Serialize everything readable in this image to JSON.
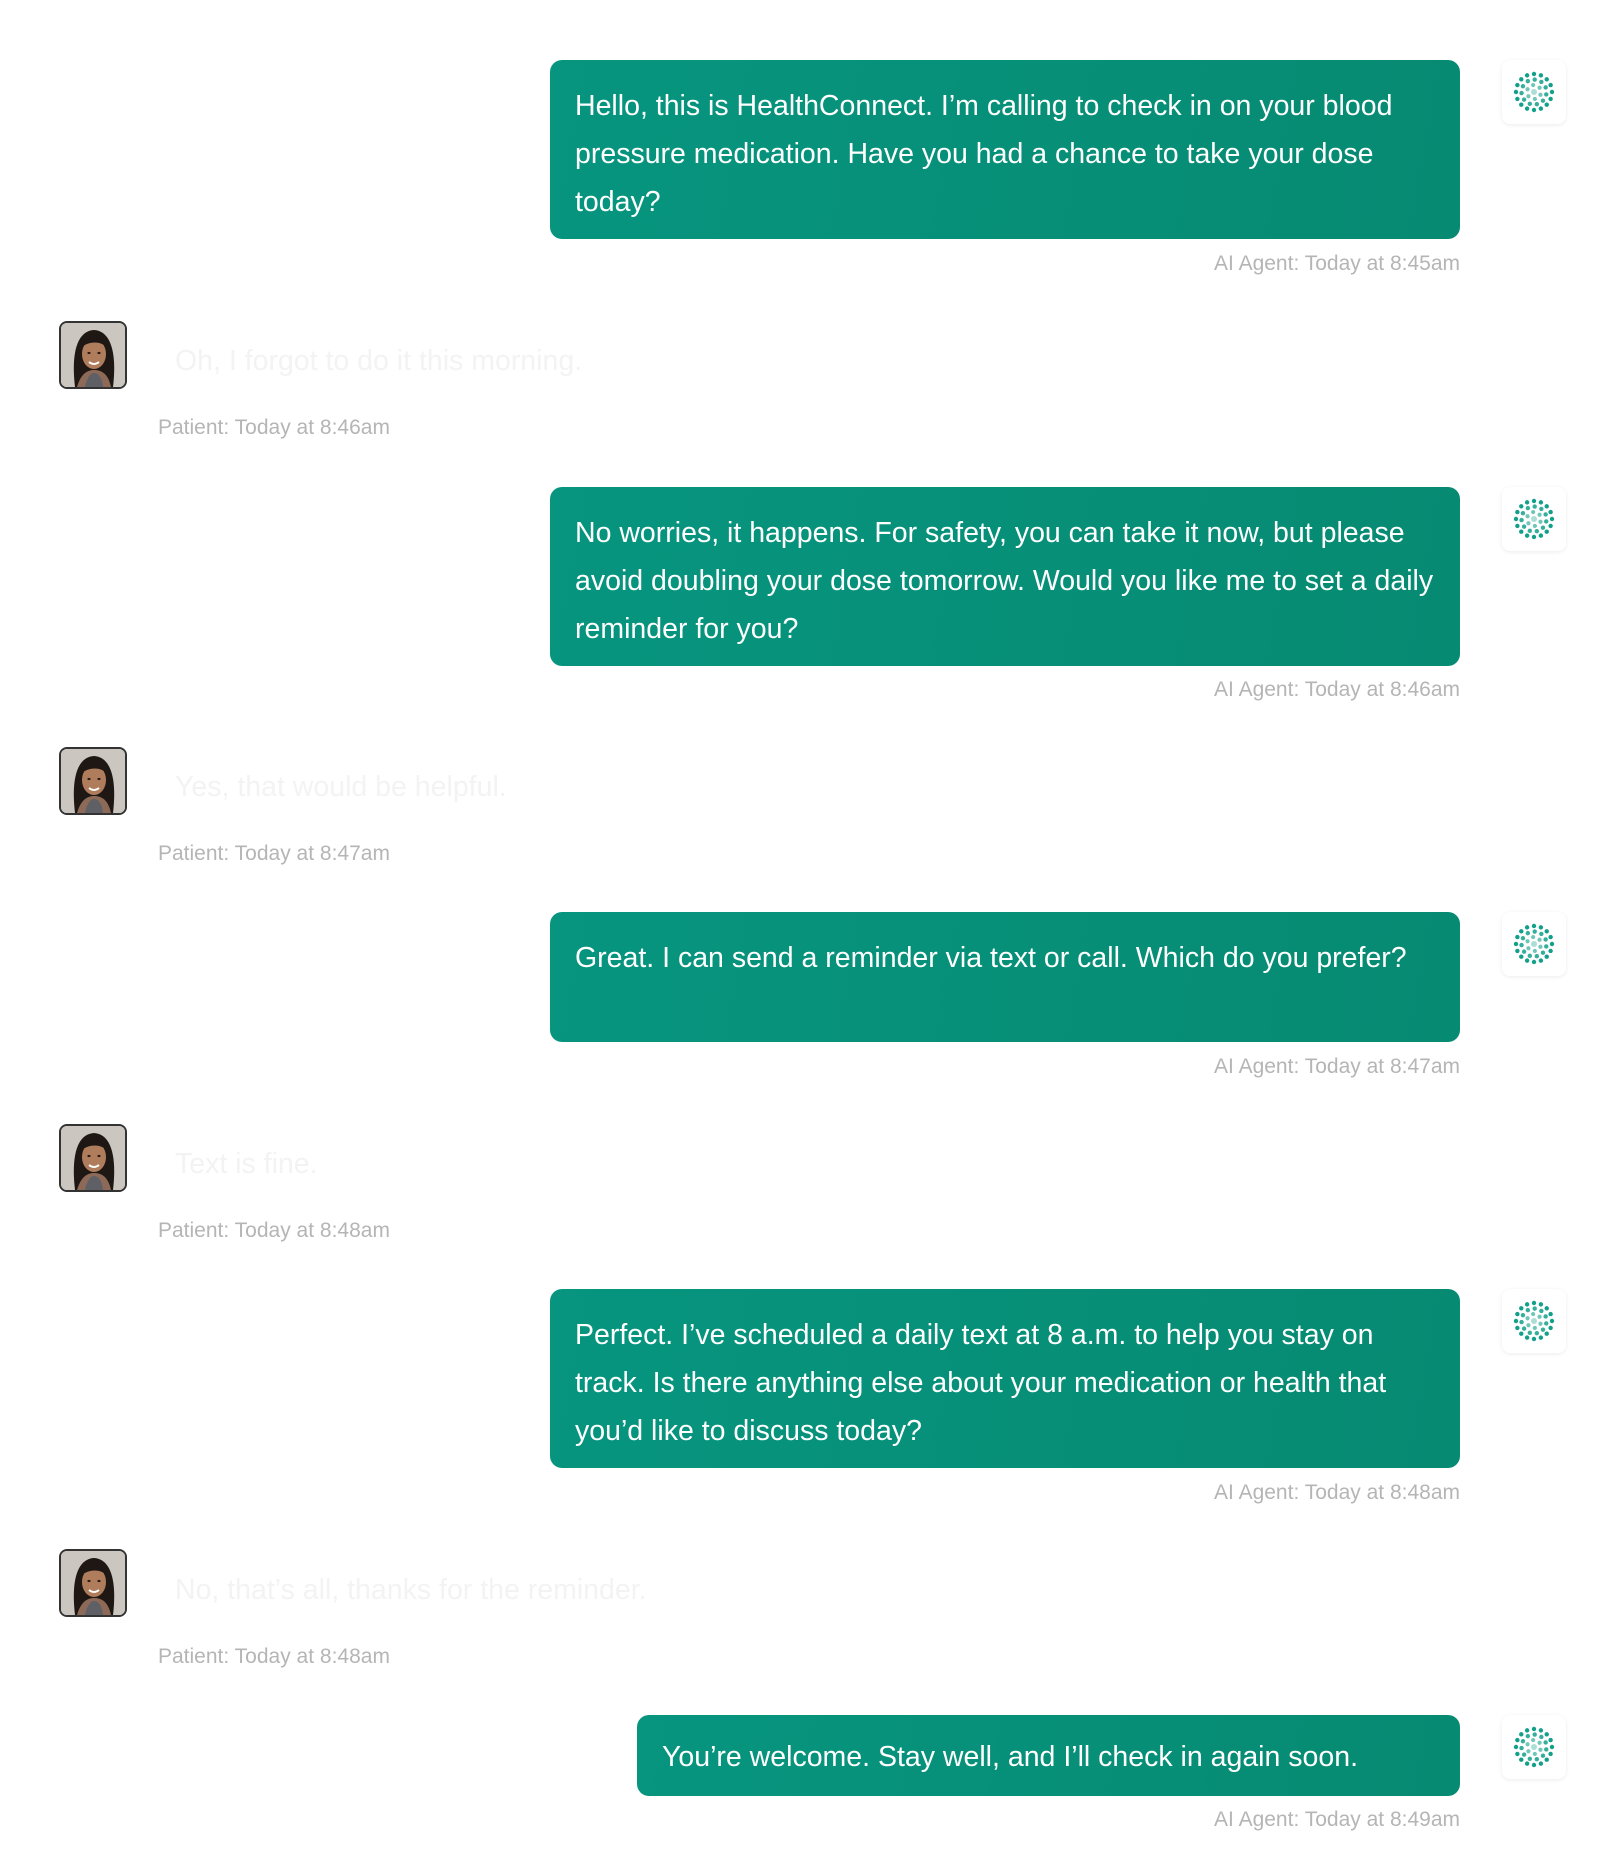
{
  "conversation": {
    "messages": [
      {
        "sender": "agent",
        "text": "Hello, this is HealthConnect. I’m calling to check in on your blood pressure medication. Have you had a chance to take your dose today?",
        "meta": "AI Agent: Today at 8:45am"
      },
      {
        "sender": "patient",
        "text": "Oh, I forgot to do it this morning.",
        "meta": "Patient: Today at 8:46am"
      },
      {
        "sender": "agent",
        "text": "No worries, it happens. For safety, you can take it now, but please avoid doubling your dose tomorrow. Would you like me to set a daily reminder for you?",
        "meta": "AI Agent: Today at 8:46am"
      },
      {
        "sender": "patient",
        "text": "Yes, that would be helpful.",
        "meta": "Patient: Today at 8:47am"
      },
      {
        "sender": "agent",
        "text": "Great. I can send a reminder via text or call. Which do you prefer?",
        "meta": "AI Agent: Today at 8:47am"
      },
      {
        "sender": "patient",
        "text": "Text is fine.",
        "meta": "Patient: Today at 8:48am"
      },
      {
        "sender": "agent",
        "text": "Perfect. I’ve scheduled a daily text at 8 a.m. to help you stay on track. Is there anything else about your medication or health that you’d like to discuss today?",
        "meta": "AI Agent: Today at 8:48am"
      },
      {
        "sender": "patient",
        "text": "No, that’s all, thanks for the reminder.",
        "meta": "Patient: Today at 8:48am"
      },
      {
        "sender": "agent",
        "text": "You’re welcome. Stay well, and I’ll check in again soon.",
        "meta": "AI Agent: Today at 8:49am"
      }
    ]
  },
  "colors": {
    "agent_bubble": "#07957f",
    "agent_text": "#ffffff",
    "meta_text": "#b5b5b5",
    "patient_text": "#f3f3f3",
    "agent_icon_dots": "#12a08a"
  },
  "icons": {
    "agent_avatar": "dotted-circle-logo-icon",
    "patient_avatar": "patient-photo-avatar"
  }
}
